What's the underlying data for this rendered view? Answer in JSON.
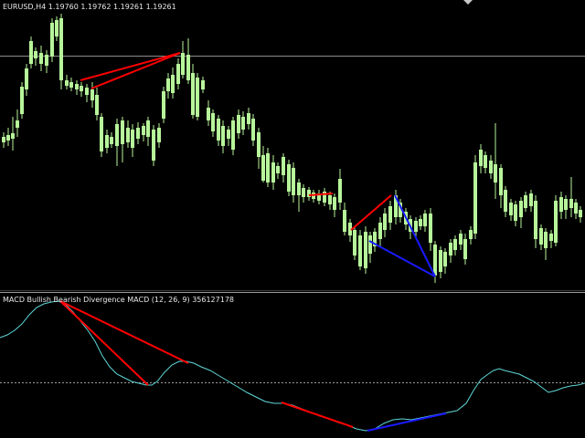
{
  "price_panel": {
    "title": "EURUSD,H4  1.19760 1.19762 1.19261 1.19261"
  },
  "macd_panel": {
    "title": "MACD Bullish Bearish Divergence MACD (12, 26, 9) 356127178"
  },
  "colors": {
    "background": "#000000",
    "candle": "#b7f59a",
    "bearish_line": "#ff0000",
    "bullish_line": "#1a1aff",
    "macd_line": "#5fd7d7",
    "separator": "#9a9a9a",
    "current_price_line": "#8c8c8c",
    "zero_line": "#9a9a9a"
  }
}
